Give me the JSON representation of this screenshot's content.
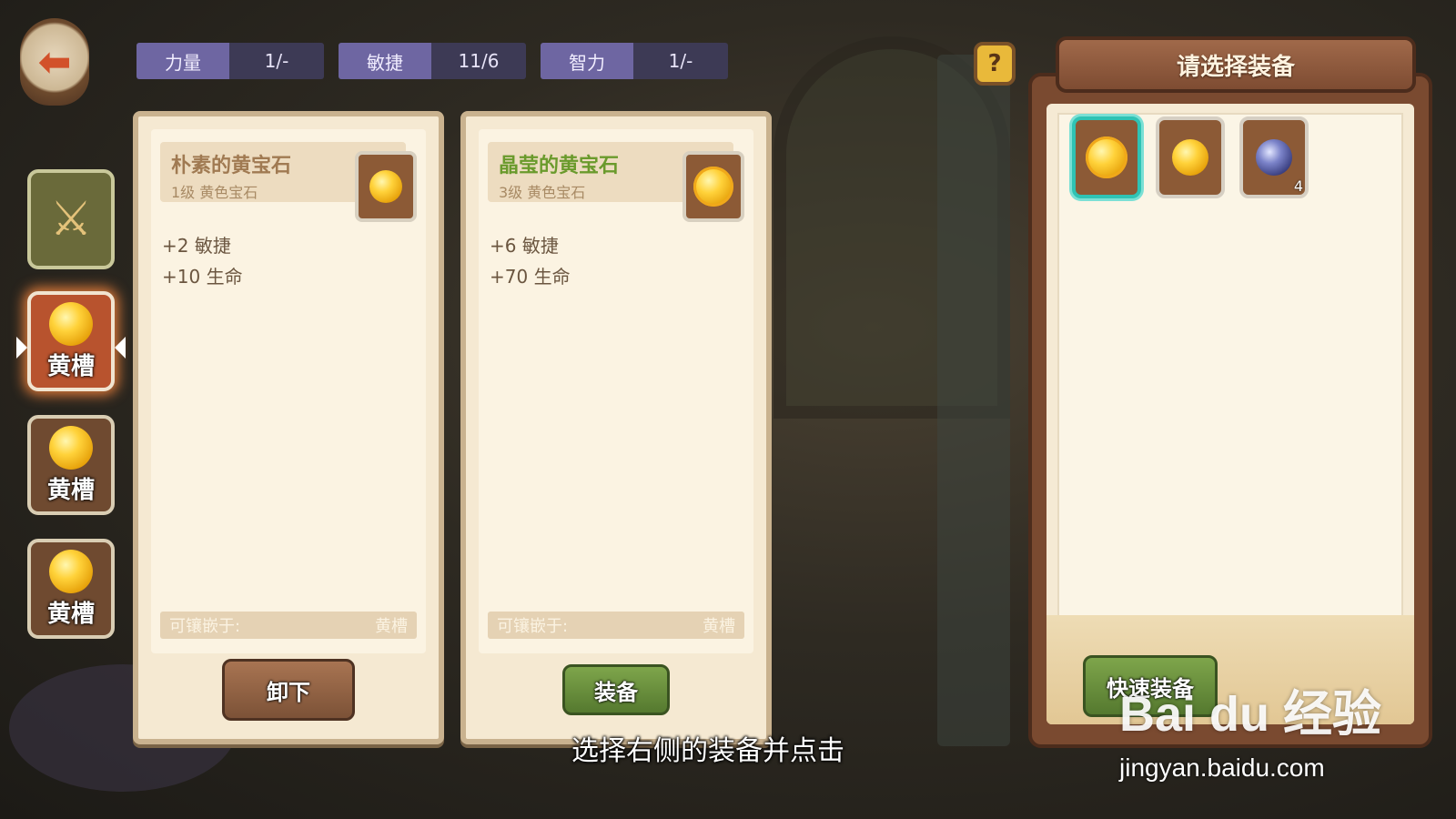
{
  "stats": [
    {
      "name": "力量",
      "value": "1/-"
    },
    {
      "name": "敏捷",
      "value": "11/6"
    },
    {
      "name": "智力",
      "value": "1/-"
    }
  ],
  "colors": {
    "stat_name_bg": "#6e66a2",
    "stat_value_bg": "#3d3a55",
    "plain_gem_name": "#a07a52",
    "crystal_gem_name": "#6a9a2c",
    "selected_border": "#2fc3b4"
  },
  "slot_tabs": [
    {
      "icon": "weapon-icon",
      "label": ""
    },
    {
      "icon": "yellow-gem-icon",
      "label": "黄槽",
      "active": true
    },
    {
      "icon": "yellow-gem-icon",
      "label": "黄槽"
    },
    {
      "icon": "yellow-gem-icon",
      "label": "黄槽"
    }
  ],
  "current_item": {
    "name": "朴素的黄宝石",
    "subtitle": "1级 黄色宝石",
    "stat_1": "+2 敏捷",
    "stat_2": "+10 生命",
    "embed_label": "可镶嵌于:",
    "embed_value": "黄槽",
    "button": "卸下",
    "icon": "yellow-gem-icon"
  },
  "candidate_item": {
    "name": "晶莹的黄宝石",
    "subtitle": "3级 黄色宝石",
    "stat_1": "+6 敏捷",
    "stat_2": "+70 生命",
    "embed_label": "可镶嵌于:",
    "embed_value": "黄槽",
    "button": "装备",
    "icon": "yellow-gem-icon"
  },
  "panel": {
    "title": "请选择装备",
    "quick_button": "快速装备",
    "inventory": [
      {
        "icon": "crystal-yellow-gem-icon",
        "count": "",
        "selected": true
      },
      {
        "icon": "yellow-gem-icon",
        "count": ""
      },
      {
        "icon": "blue-gem-icon",
        "count": "4"
      }
    ]
  },
  "caption": "选择右侧的装备并点击",
  "watermark": {
    "brand": "Bai du 经验",
    "url": "jingyan.baidu.com"
  }
}
